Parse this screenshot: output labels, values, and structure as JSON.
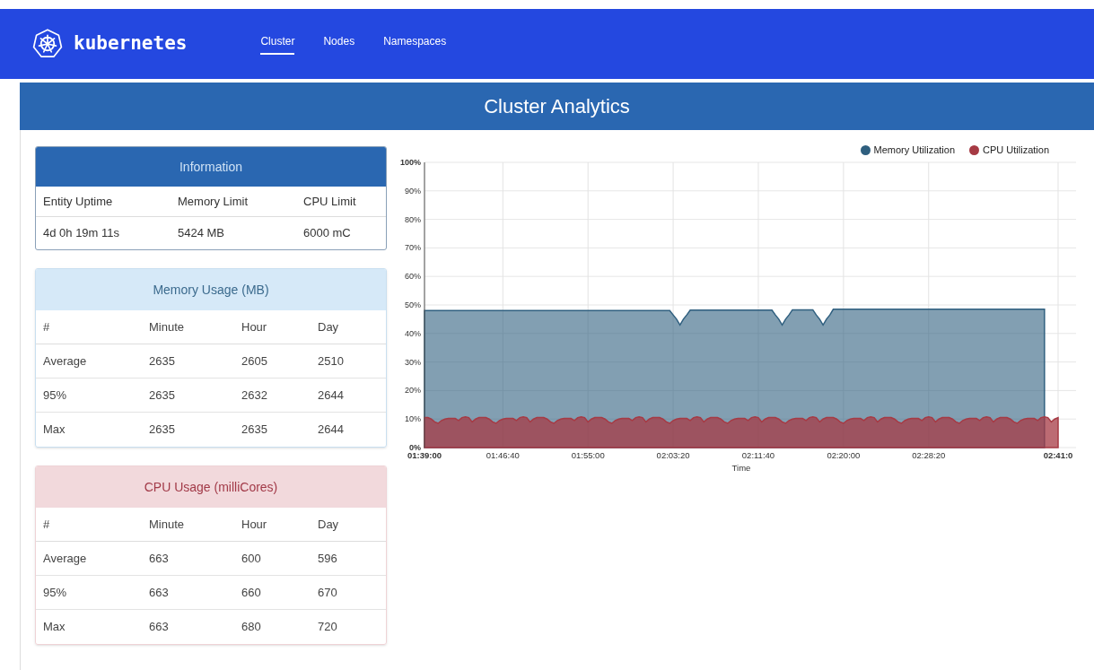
{
  "brand": {
    "name": "kubernetes"
  },
  "nav": [
    {
      "label": "Cluster",
      "selected": true
    },
    {
      "label": "Nodes",
      "selected": false
    },
    {
      "label": "Namespaces",
      "selected": false
    }
  ],
  "page_title": "Cluster Analytics",
  "info": {
    "title": "Information",
    "columns": [
      "Entity Uptime",
      "Memory Limit",
      "CPU Limit"
    ],
    "values": [
      "4d 0h 19m 11s",
      "5424 MB",
      "6000 mC"
    ]
  },
  "usage_tables": [
    {
      "kind": "memory",
      "title": "Memory Usage (MB)",
      "columns": [
        "#",
        "Minute",
        "Hour",
        "Day"
      ],
      "rows": [
        [
          "Average",
          "2635",
          "2605",
          "2510"
        ],
        [
          "95%",
          "2635",
          "2632",
          "2644"
        ],
        [
          "Max",
          "2635",
          "2635",
          "2644"
        ]
      ]
    },
    {
      "kind": "cpu",
      "title": "CPU Usage (milliCores)",
      "columns": [
        "#",
        "Minute",
        "Hour",
        "Day"
      ],
      "rows": [
        [
          "Average",
          "663",
          "600",
          "596"
        ],
        [
          "95%",
          "663",
          "660",
          "670"
        ],
        [
          "Max",
          "663",
          "680",
          "720"
        ]
      ]
    }
  ],
  "chart": {
    "chart_data": {
      "type": "area",
      "xlabel": "Time",
      "categories": [
        "01:39:00",
        null,
        null,
        null,
        null,
        null,
        null,
        null,
        null,
        null,
        null,
        null,
        null,
        null,
        null,
        null,
        null,
        null,
        null,
        null,
        null,
        null,
        null,
        "01:46:40",
        null,
        null,
        null,
        null,
        null,
        null,
        null,
        null,
        null,
        null,
        null,
        null,
        null,
        null,
        null,
        null,
        null,
        null,
        null,
        null,
        null,
        null,
        null,
        null,
        "01:55:00",
        null,
        null,
        null,
        null,
        null,
        null,
        null,
        null,
        null,
        null,
        null,
        null,
        null,
        null,
        null,
        null,
        null,
        null,
        null,
        null,
        null,
        null,
        null,
        null,
        "02:03:20",
        null,
        null,
        null,
        null,
        null,
        null,
        null,
        null,
        null,
        null,
        null,
        null,
        null,
        null,
        null,
        null,
        null,
        null,
        null,
        null,
        null,
        null,
        null,
        null,
        "02:11:40",
        null,
        null,
        null,
        null,
        null,
        null,
        null,
        null,
        null,
        null,
        null,
        null,
        null,
        null,
        null,
        null,
        null,
        null,
        null,
        null,
        null,
        null,
        null,
        null,
        "02:20:00",
        null,
        null,
        null,
        null,
        null,
        null,
        null,
        null,
        null,
        null,
        null,
        null,
        null,
        null,
        null,
        null,
        null,
        null,
        null,
        null,
        null,
        null,
        null,
        null,
        "02:28:20",
        null,
        null,
        null,
        null,
        null,
        null,
        null,
        null,
        null,
        null,
        null,
        null,
        null,
        null,
        null,
        null,
        null,
        null,
        null,
        null,
        null,
        null,
        null,
        null,
        null,
        null,
        null,
        null,
        null,
        null,
        null,
        null,
        null,
        null,
        null,
        null,
        null,
        "02:41:0"
      ],
      "series": [
        {
          "name": "Memory Utilization",
          "color": "#2f5f7f",
          "values": [
            48,
            48,
            48,
            48,
            48,
            48,
            48,
            48,
            48,
            48,
            48,
            48,
            48,
            48,
            48,
            48,
            48,
            48,
            48,
            48,
            48,
            48,
            48,
            48,
            48,
            48,
            48,
            48,
            48,
            48,
            48,
            48,
            48,
            48,
            48,
            48,
            48,
            48,
            48,
            48,
            48,
            48,
            48,
            48,
            48,
            48,
            48,
            48,
            48,
            48,
            48,
            48,
            48,
            48,
            48,
            48,
            48,
            48,
            48,
            48,
            48,
            48,
            48,
            48,
            48,
            48,
            48,
            48,
            48,
            48,
            48,
            48,
            48,
            46.5,
            45,
            43,
            45,
            46.5,
            48.2,
            48.2,
            48.2,
            48.2,
            48.2,
            48.2,
            48.2,
            48.2,
            48.2,
            48.2,
            48.2,
            48.2,
            48.2,
            48.2,
            48.2,
            48.2,
            48.2,
            48.2,
            48.2,
            48.2,
            48.2,
            48.2,
            48.2,
            48.2,
            48.2,
            46.5,
            45,
            43,
            45,
            46.5,
            48.3,
            48.3,
            48.3,
            48.3,
            48.3,
            48.3,
            48.3,
            46.5,
            45,
            43,
            45,
            46.5,
            48.5,
            48.5,
            48.5,
            48.5,
            48.5,
            48.5,
            48.5,
            48.5,
            48.5,
            48.5,
            48.5,
            48.5,
            48.5,
            48.5,
            48.5,
            48.5,
            48.5,
            48.5,
            48.5,
            48.5,
            48.5,
            48.5,
            48.5,
            48.5,
            48.5,
            48.5,
            48.5,
            48.5,
            48.5,
            48.5,
            48.5,
            48.5,
            48.5,
            48.5,
            48.5,
            48.5,
            48.5,
            48.5,
            48.5,
            48.5,
            48.5,
            48.5,
            48.5,
            48.5,
            48.5,
            48.5,
            48.5,
            48.5,
            48.5,
            48.5,
            48.5,
            48.5,
            48.5,
            48.5,
            48.5,
            48.5,
            48.5,
            48.5,
            48.5,
            48.5,
            48.5,
            48.5,
            48.5,
            null,
            null,
            null,
            null
          ]
        },
        {
          "name": "CPU Utilization",
          "color": "#a63a44",
          "values": [
            10.5,
            10.5,
            10,
            9,
            8.5,
            9.5,
            10,
            10.2,
            10.2,
            10.2,
            9.5,
            10.5,
            10.8,
            10.5,
            9,
            10,
            10.5,
            10.5,
            10.5,
            10,
            9,
            8.5,
            9.5,
            10,
            10.2,
            10.2,
            10.2,
            9.5,
            10.5,
            10.8,
            10.5,
            9,
            10,
            10.5,
            10.5,
            10.5,
            10,
            9,
            8.5,
            9.5,
            10,
            10.2,
            10.2,
            10.2,
            9.5,
            10.5,
            10.8,
            10.5,
            9,
            10,
            10.5,
            10.5,
            10.5,
            10,
            9,
            8.5,
            9.5,
            10,
            10.2,
            10.2,
            10.2,
            9.5,
            10.5,
            10.8,
            10.5,
            9,
            10,
            10.5,
            10.5,
            10.5,
            10,
            9,
            8.5,
            9.5,
            10,
            10.2,
            10.2,
            10.2,
            9.5,
            10.5,
            10.8,
            10.5,
            9,
            10,
            10.5,
            10.5,
            10.5,
            10,
            9,
            8.5,
            9.5,
            10,
            10.2,
            10.2,
            10.2,
            9.5,
            10.5,
            10.8,
            10.5,
            9,
            10,
            10.5,
            10.5,
            10.5,
            10,
            9,
            8.5,
            9.5,
            10,
            10.2,
            10.2,
            10.2,
            9.5,
            10.5,
            10.8,
            10.5,
            9,
            10,
            10.5,
            10.5,
            10.5,
            10,
            9,
            8.5,
            9.5,
            10,
            10.2,
            10.2,
            10.2,
            9.5,
            10.5,
            10.8,
            10.5,
            9,
            10,
            10.5,
            10.5,
            10.5,
            10,
            9,
            8.5,
            9.5,
            10,
            10.2,
            10.2,
            10.2,
            9.5,
            10.5,
            10.8,
            10.5,
            9,
            10,
            10.5,
            10.5,
            10.5,
            10,
            9,
            8.5,
            9.5,
            10,
            10.2,
            10.2,
            10.2,
            9.5,
            10.5,
            10.8,
            10.5,
            9,
            10,
            10.5,
            10.5,
            10.5,
            10,
            9,
            8.5,
            9.5,
            10,
            10.2,
            10.2,
            10.2,
            9.5,
            10.5,
            10.8,
            10.5,
            9,
            10,
            10.5
          ]
        }
      ],
      "ylim": [
        0,
        100
      ],
      "grid": true,
      "legend": "top-right",
      "yticks": [
        {
          "value": 0,
          "label": "0%"
        },
        {
          "value": 10,
          "label": "10%"
        },
        {
          "value": 20,
          "label": "20%"
        },
        {
          "value": 30,
          "label": "30%"
        },
        {
          "value": 40,
          "label": "40%"
        },
        {
          "value": 50,
          "label": "50%"
        },
        {
          "value": 60,
          "label": "60%"
        },
        {
          "value": 70,
          "label": "70%"
        },
        {
          "value": 80,
          "label": "80%"
        },
        {
          "value": 90,
          "label": "90%"
        },
        {
          "value": 100,
          "label": "100%"
        }
      ]
    }
  }
}
